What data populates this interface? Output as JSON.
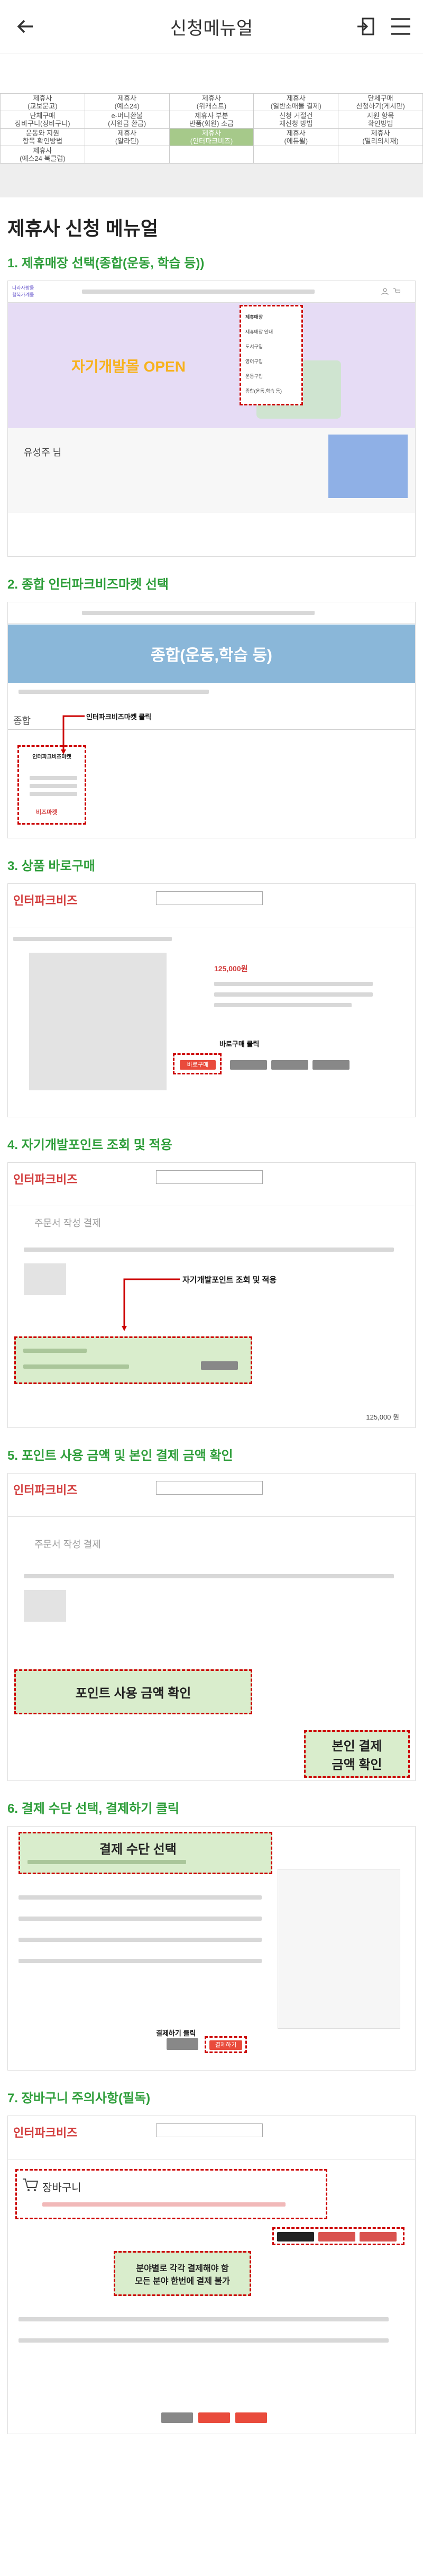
{
  "header": {
    "title": "신청메뉴얼"
  },
  "menu_grid": [
    [
      "제휴사\n(교보문고)",
      "제휴사\n(예스24)",
      "제휴사\n(위캐스트)",
      "제휴사\n(일반소매몰 결제)",
      "단체구매\n신청하기(게시판)"
    ],
    [
      "단체구매\n장바구니(장바구니)",
      "e-머니환불\n(지원금 환급)",
      "제휴사 부분\n반품(회원) 소급",
      "신청 거절건\n재신청 방법",
      "지원 항목\n확인방법"
    ],
    [
      "운동와 지원\n항목 확인방법",
      "제휴사\n(알라딘)",
      "제휴사\n(인터파크비즈)",
      "제휴사\n(에듀윌)",
      "제휴사\n(밀리의서재)"
    ],
    [
      "제휴사\n(예스24 북클럽)",
      "",
      "",
      "",
      ""
    ]
  ],
  "menu_active": "제휴사\n(인터파크비즈)",
  "page_title": "제휴사 신청 메뉴얼",
  "steps": [
    {
      "title": "1. 제휴매장 선택(종합(운동, 학습 등))"
    },
    {
      "title": "2. 종합 인터파크비즈마켓 선택"
    },
    {
      "title": "3. 상품 바로구매"
    },
    {
      "title": "4. 자기개발포인트 조회 및 적용"
    },
    {
      "title": "5. 포인트 사용 금액 및 본인 결제 금액 확인"
    },
    {
      "title": "6. 결제 수단 선택, 결제하기 클릭"
    },
    {
      "title": "7. 장바구니 주의사항(필독)"
    }
  ],
  "s1": {
    "brand": "나라사랑몰\n행복가계몰",
    "dropdown": [
      "제휴매장",
      "제휴매장 안내",
      "도서구입",
      "영어구입",
      "운동구입",
      "종합(운동,학습 등)"
    ],
    "banner": "자기개발몰 OPEN",
    "user": "유성주 님"
  },
  "s2": {
    "banner": "종합(운동,학습 등)",
    "section_label": "종합",
    "card_title": "인터파크비즈마켓",
    "card_logo": "비즈마켓",
    "callout": "인터파크비즈마켓 클릭"
  },
  "s3": {
    "logo": "인터파크비즈",
    "price": "125,000원",
    "buy_btn": "바로구매",
    "callout": "바로구매 클릭"
  },
  "s4": {
    "logo": "인터파크비즈",
    "page": "주문서 작성 결제",
    "callout": "자기개발포인트 조회 및 적용",
    "total": "125,000 원"
  },
  "s5": {
    "logo": "인터파크비즈",
    "page": "주문서 작성 결제",
    "callout1": "포인트 사용 금액 확인",
    "callout2": "본인 결제\n금액 확인"
  },
  "s6": {
    "callout1": "결제 수단 선택",
    "callout2": "결제하기 클릭",
    "pay_btn": "결제하기"
  },
  "s7": {
    "logo": "인터파크비즈",
    "cart": "장바구니",
    "callout": "분야별로 각각 결제해야 함\n모든 분야 한번에 결제 불가"
  },
  "colors": {
    "accent_green": "#2e9e3a",
    "highlight_red": "#cc0000",
    "active_cell": "#a6c98a"
  }
}
